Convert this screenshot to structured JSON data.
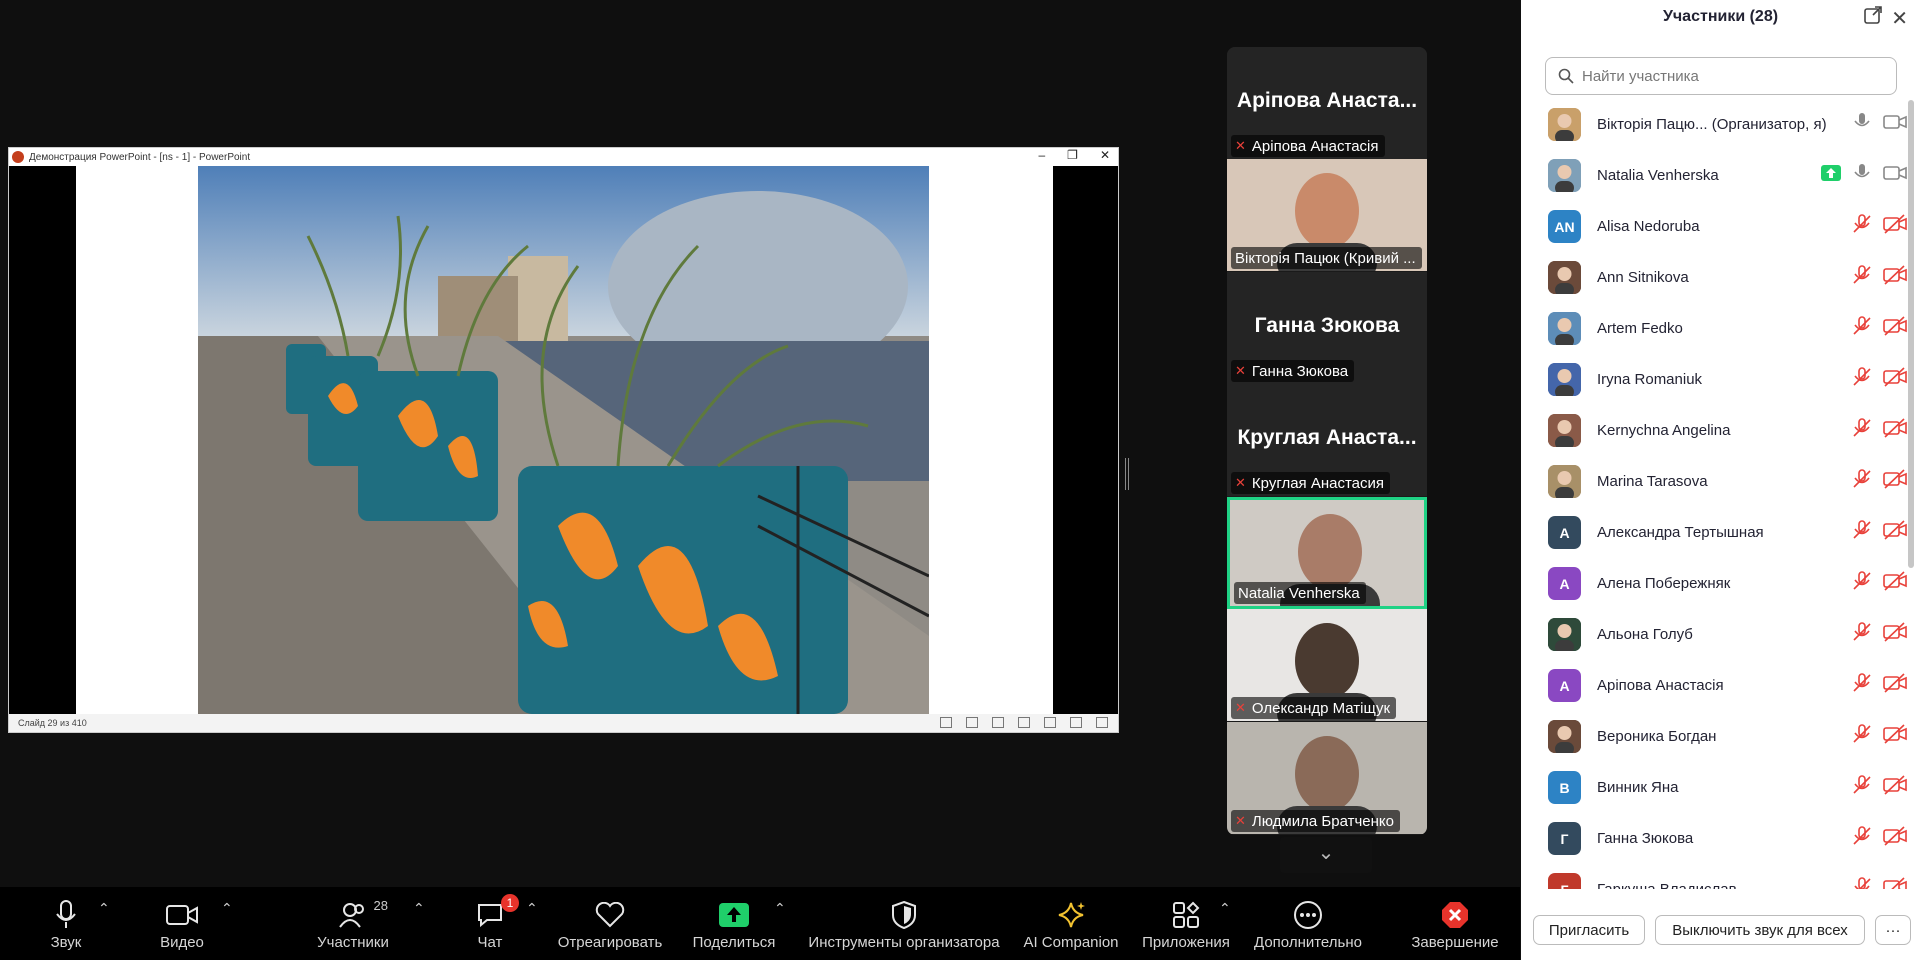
{
  "share": {
    "window_title": "Демонстрация PowerPoint - [ns - 1] - PowerPoint",
    "status": "Слайд 29 из 410"
  },
  "gallery": {
    "tiles": [
      {
        "big_name": "Аріпова Анаста...",
        "tag": "Аріпова Анастасія",
        "muted": true
      },
      {
        "big_name": "",
        "tag": "Вікторія Пацюк (Кривий ...",
        "muted": false
      },
      {
        "big_name": "Ганна Зюкова",
        "tag": "Ганна Зюкова",
        "muted": true
      },
      {
        "big_name": "Круглая Анаста...",
        "tag": "Круглая Анастасия",
        "muted": true
      },
      {
        "big_name": "",
        "tag": "Natalia Venherska",
        "muted": false,
        "active": true
      },
      {
        "big_name": "",
        "tag": "Олександр Матіщук",
        "muted": true
      },
      {
        "big_name": "",
        "tag": "Людмила Братченко",
        "muted": true
      }
    ]
  },
  "toolbar": {
    "audio": "Звук",
    "video": "Видео",
    "participants": "Участники",
    "participants_count": "28",
    "chat": "Чат",
    "chat_badge": "1",
    "react": "Отреагировать",
    "share": "Поделиться",
    "host_tools": "Инструменты организатора",
    "ai": "AI Companion",
    "apps": "Приложения",
    "more": "Дополнительно",
    "end": "Завершение"
  },
  "panel": {
    "title": "Участники (28)",
    "search_placeholder": "Найти участника",
    "invite": "Пригласить",
    "mute_all": "Выключить звук для всех",
    "more": "···",
    "participants": [
      {
        "name": "Вікторія Пацю...  (Организатор, я)",
        "avatar": "",
        "color": "#c9a06a",
        "photo": true,
        "mic": "on",
        "cam": "on"
      },
      {
        "name": "Natalia Venherska",
        "avatar": "",
        "color": "#7fa0b8",
        "photo": true,
        "mic": "on",
        "cam": "on",
        "sharing": true
      },
      {
        "name": "Alisa Nedoruba",
        "avatar": "AN",
        "color": "#2d83c5",
        "photo": false,
        "mic": "off",
        "cam": "off"
      },
      {
        "name": "Ann Sitnikova",
        "avatar": "",
        "color": "#6b4a3a",
        "photo": true,
        "mic": "off",
        "cam": "off"
      },
      {
        "name": "Artem Fedko",
        "avatar": "",
        "color": "#5d8db8",
        "photo": true,
        "mic": "off",
        "cam": "off"
      },
      {
        "name": "Iryna Romaniuk",
        "avatar": "",
        "color": "#4466aa",
        "photo": true,
        "mic": "off",
        "cam": "off"
      },
      {
        "name": "Kernychna Angelina",
        "avatar": "",
        "color": "#8a5a48",
        "photo": true,
        "mic": "off",
        "cam": "off"
      },
      {
        "name": "Marina Tarasova",
        "avatar": "",
        "color": "#a89068",
        "photo": true,
        "mic": "off",
        "cam": "off"
      },
      {
        "name": "Александра Тертышная",
        "avatar": "А",
        "color": "#334a5e",
        "photo": false,
        "mic": "off",
        "cam": "off"
      },
      {
        "name": "Алена Побережняк",
        "avatar": "А",
        "color": "#8a48c2",
        "photo": false,
        "mic": "off",
        "cam": "off"
      },
      {
        "name": "Альона Голуб",
        "avatar": "",
        "color": "#2e4a3a",
        "photo": true,
        "mic": "off",
        "cam": "off"
      },
      {
        "name": "Аріпова Анастасія",
        "avatar": "А",
        "color": "#8a48c2",
        "photo": false,
        "mic": "off",
        "cam": "off"
      },
      {
        "name": "Вероника Богдан",
        "avatar": "",
        "color": "#6a4a3a",
        "photo": true,
        "mic": "off",
        "cam": "off"
      },
      {
        "name": "Винник Яна",
        "avatar": "В",
        "color": "#2d83c5",
        "photo": false,
        "mic": "off",
        "cam": "off"
      },
      {
        "name": "Ганна Зюкова",
        "avatar": "Г",
        "color": "#334a5e",
        "photo": false,
        "mic": "off",
        "cam": "off"
      },
      {
        "name": "Гаркуша Владислав",
        "avatar": "Г",
        "color": "#c0392b",
        "photo": false,
        "mic": "off",
        "cam": "off"
      }
    ]
  },
  "colors": {
    "active_speaker": "#1fd285",
    "share_green": "#1fcf6a",
    "end_red": "#e8332b",
    "mute_red": "#e8413a"
  }
}
